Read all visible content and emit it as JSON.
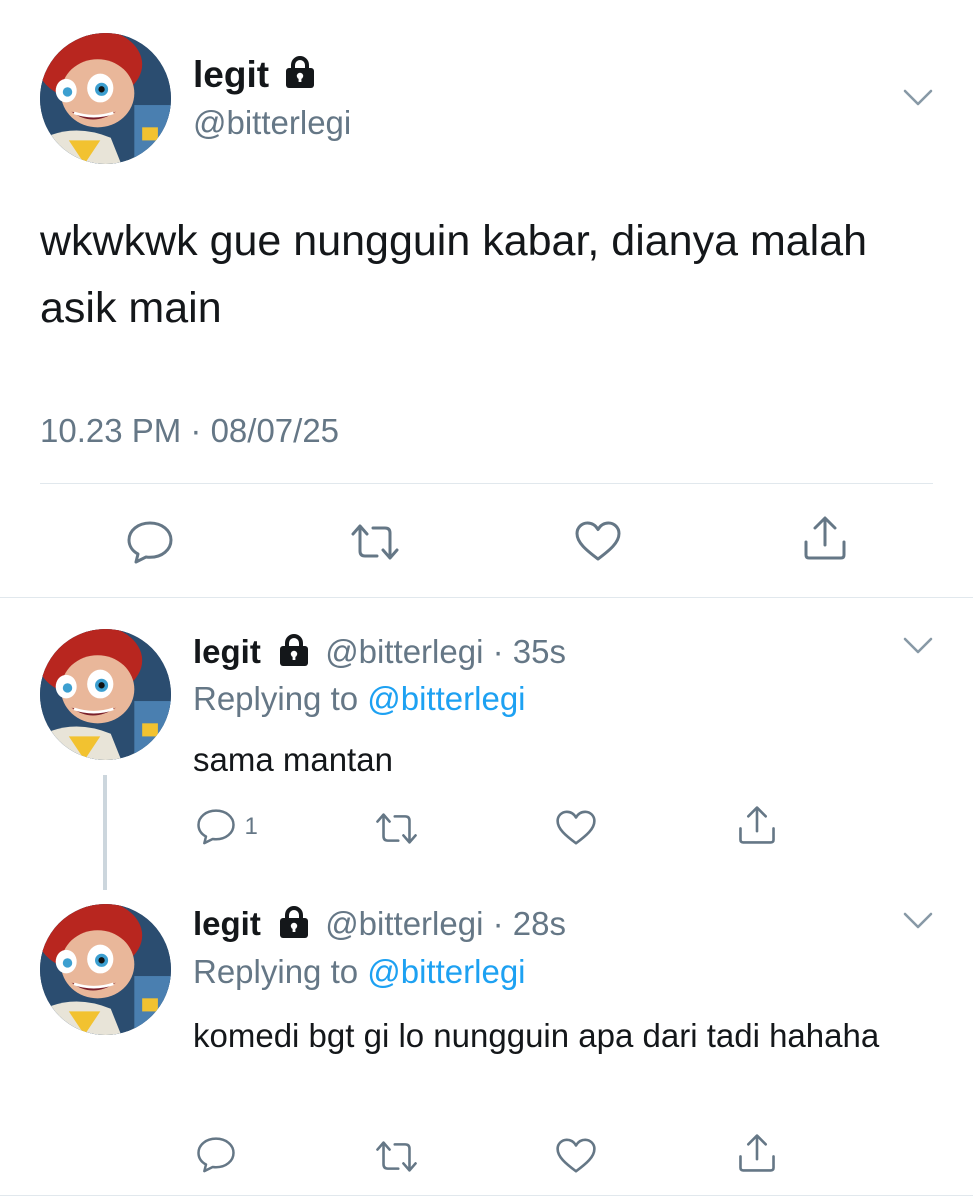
{
  "colors": {
    "text": "#14171a",
    "secondary": "#657786",
    "link": "#1da1f2",
    "divider": "#e1e8ed",
    "thread_line": "#ccd6dd"
  },
  "icons": [
    "lock-icon",
    "chevron-down-icon",
    "reply-icon",
    "retweet-icon",
    "like-icon",
    "share-icon"
  ],
  "main_tweet": {
    "display_name": "legit",
    "handle": "@bitterlegi",
    "text": "wkwkwk gue nungguin kabar, dianya malah asik main",
    "timestamp": "10.23 PM · 08/07/25"
  },
  "replies": [
    {
      "display_name": "legit",
      "handle": "@bitterlegi",
      "time": "· 35s",
      "replying_prefix": "Replying to",
      "replying_to": "@bitterlegi",
      "text": "sama mantan",
      "reply_count": "1"
    },
    {
      "display_name": "legit",
      "handle": "@bitterlegi",
      "time": "· 28s",
      "replying_prefix": "Replying to",
      "replying_to": "@bitterlegi",
      "text": "komedi bgt gi lo nungguin apa dari tadi hahaha",
      "reply_count": ""
    }
  ]
}
